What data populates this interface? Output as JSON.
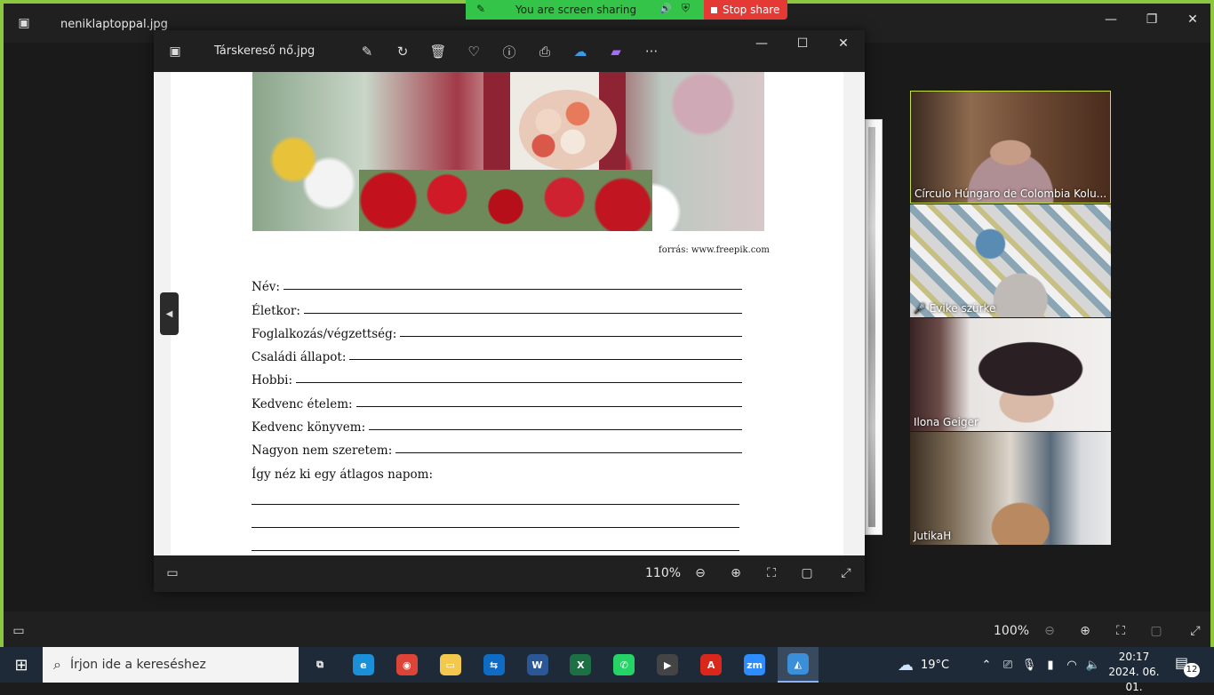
{
  "outer_window": {
    "title": "neniklaptoppal.jpg",
    "zoom": "100%"
  },
  "screen_share": {
    "status": "You are screen sharing",
    "stop_label": "Stop share"
  },
  "viewer": {
    "title": "Társkereső nő.jpg",
    "zoom": "110%"
  },
  "document": {
    "credit": "forrás: www.freepik.com",
    "fields": [
      {
        "label": "Név:"
      },
      {
        "label": "Életkor:"
      },
      {
        "label": "Foglalkozás/végzettség:"
      },
      {
        "label": "Családi állapot:"
      },
      {
        "label": "Hobbi:"
      },
      {
        "label": "Kedvenc ételem:"
      },
      {
        "label": "Kedvenc könyvem:"
      },
      {
        "label": "Nagyon nem szeretem:"
      }
    ],
    "open_prompt": "Így néz ki egy átlagos napom:"
  },
  "participants": [
    {
      "name": "Círculo Húngaro de Colombia Kolu...",
      "muted": false,
      "active": true
    },
    {
      "name": "Evike szürke",
      "muted": true,
      "active": false
    },
    {
      "name": "Ilona Geiger",
      "muted": false,
      "active": false
    },
    {
      "name": "JutikaH",
      "muted": false,
      "active": false
    }
  ],
  "taskbar": {
    "search_placeholder": "Írjon ide a kereséshez",
    "apps": [
      {
        "name": "Task View",
        "color": "#1e2a38",
        "glyph": "⧉"
      },
      {
        "name": "Edge",
        "color": "#1b8fd8",
        "glyph": "e"
      },
      {
        "name": "Chrome",
        "color": "#db4437",
        "glyph": "◉"
      },
      {
        "name": "File Explorer",
        "color": "#f2c94c",
        "glyph": "▭"
      },
      {
        "name": "TeamViewer",
        "color": "#0e6cc4",
        "glyph": "⇆"
      },
      {
        "name": "Word",
        "color": "#2b5797",
        "glyph": "W"
      },
      {
        "name": "Excel",
        "color": "#1d7044",
        "glyph": "X"
      },
      {
        "name": "WhatsApp",
        "color": "#25d366",
        "glyph": "✆"
      },
      {
        "name": "Media Player",
        "color": "#444444",
        "glyph": "▶"
      },
      {
        "name": "Acrobat",
        "color": "#d9271b",
        "glyph": "A"
      },
      {
        "name": "Zoom",
        "color": "#2d8cff",
        "glyph": "zm"
      },
      {
        "name": "Photos",
        "color": "#3b8ed8",
        "glyph": "◭"
      }
    ],
    "weather": "19°C",
    "time": "20:17",
    "date": "2024. 06. 01.",
    "notifications": "12"
  }
}
